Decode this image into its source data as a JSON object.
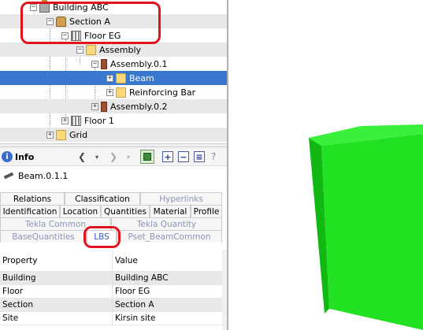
{
  "tree": {
    "items": [
      {
        "label": "Building ABC",
        "icon": "building-icon",
        "toggle": "−"
      },
      {
        "label": "Section A",
        "icon": "section-icon",
        "toggle": "−"
      },
      {
        "label": "Floor  EG",
        "icon": "floor-icon",
        "toggle": "−"
      },
      {
        "label": "Assembly",
        "icon": "folder-icon",
        "toggle": "−"
      },
      {
        "label": "Assembly.0.1",
        "icon": "assembly-icon",
        "toggle": "−"
      },
      {
        "label": "Beam",
        "icon": "folder-icon",
        "toggle": "+"
      },
      {
        "label": "Reinforcing Bar",
        "icon": "folder-icon",
        "toggle": "+"
      },
      {
        "label": "Assembly.0.2",
        "icon": "assembly-icon",
        "toggle": "+"
      },
      {
        "label": "Floor 1",
        "icon": "floor-icon",
        "toggle": "+"
      },
      {
        "label": "Grid",
        "icon": "folder-icon",
        "toggle": "+"
      }
    ]
  },
  "info": {
    "title": "Info",
    "icon_glyph": "i",
    "object_name": "Beam.0.1.1",
    "nav": {
      "back": "❮",
      "forward": "❯",
      "dropdown": "▾"
    },
    "tools": {
      "expand": "+",
      "collapse": "−",
      "list": "≡",
      "help": "?"
    }
  },
  "tabs": {
    "row1": [
      "Relations",
      "Classification",
      "Hyperlinks"
    ],
    "row2": [
      "Identification",
      "Location",
      "Quantities",
      "Material",
      "Profile"
    ],
    "row3": [
      "Tekla Common",
      "Tekla Quantity"
    ],
    "row4": [
      "BaseQuantities",
      "LBS",
      "Pset_BeamCommon"
    ]
  },
  "properties": {
    "header": {
      "property": "Property",
      "value": "Value"
    },
    "rows": [
      {
        "property": "Building",
        "value": "Building ABC"
      },
      {
        "property": "Floor",
        "value": "Floor  EG"
      },
      {
        "property": "Section",
        "value": "Section A"
      },
      {
        "property": "Site",
        "value": "Kirsin site"
      }
    ]
  },
  "colors": {
    "selection": "#3a78d0",
    "annotation": "#e0141e",
    "model_front": "#22e022",
    "model_side": "#12b812",
    "model_top": "#3af03a"
  }
}
